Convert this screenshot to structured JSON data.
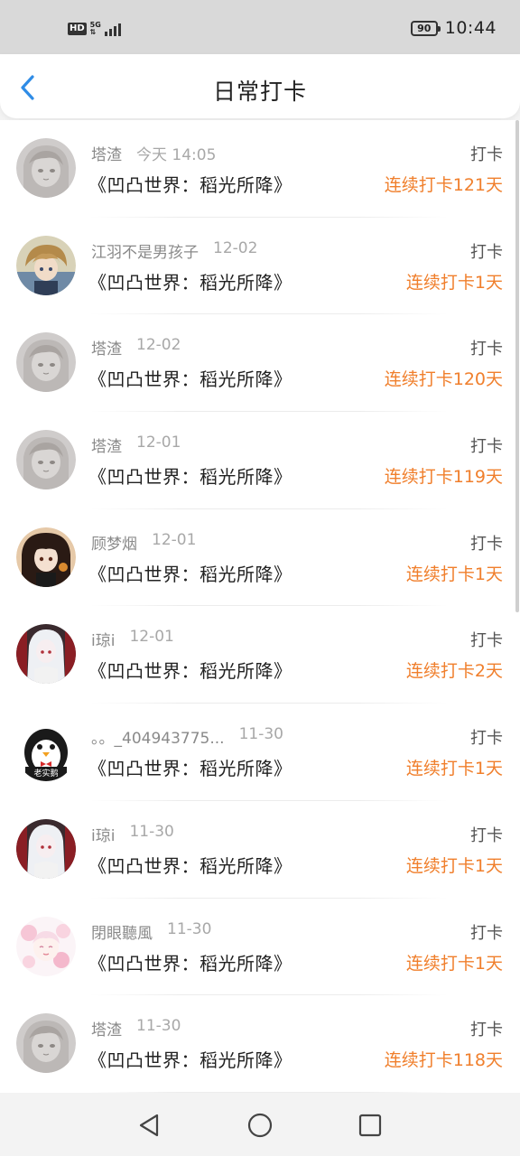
{
  "status_bar": {
    "hd": "HD",
    "network": "5G",
    "battery": "90",
    "time": "10:44",
    "icons": [
      "hd-icon",
      "signal-icon",
      "battery-icon"
    ]
  },
  "header": {
    "title": "日常打卡",
    "back_icon": "chevron-left-icon",
    "accent_color": "#2f8ce6"
  },
  "checkin_label": "打卡",
  "entries": [
    {
      "name": "塔渣",
      "time": "今天 14:05",
      "book": "《凹凸世界：稻光所降》",
      "action": "打卡",
      "streak": "连续打卡121天",
      "avatar": "sketch-girl"
    },
    {
      "name": "江羽不是男孩子",
      "time": "12-02",
      "book": "《凹凸世界：稻光所降》",
      "action": "打卡",
      "streak": "连续打卡1天",
      "avatar": "anime-boy"
    },
    {
      "name": "塔渣",
      "time": "12-02",
      "book": "《凹凸世界：稻光所降》",
      "action": "打卡",
      "streak": "连续打卡120天",
      "avatar": "sketch-girl"
    },
    {
      "name": "塔渣",
      "time": "12-01",
      "book": "《凹凸世界：稻光所降》",
      "action": "打卡",
      "streak": "连续打卡119天",
      "avatar": "sketch-girl"
    },
    {
      "name": "顾梦烟",
      "time": "12-01",
      "book": "《凹凸世界：稻光所降》",
      "action": "打卡",
      "streak": "连续打卡1天",
      "avatar": "dark-hair-girl"
    },
    {
      "name": "i琼i",
      "time": "12-01",
      "book": "《凹凸世界：稻光所降》",
      "action": "打卡",
      "streak": "连续打卡2天",
      "avatar": "white-hair-girl"
    },
    {
      "name": "。。_404943775...",
      "time": "11-30",
      "book": "《凹凸世界：稻光所降》",
      "action": "打卡",
      "streak": "连续打卡1天",
      "avatar": "penguin",
      "avatar_text": "老实鹅"
    },
    {
      "name": "i琼i",
      "time": "11-30",
      "book": "《凹凸世界：稻光所降》",
      "action": "打卡",
      "streak": "连续打卡1天",
      "avatar": "white-hair-girl"
    },
    {
      "name": "閉眼聽風",
      "time": "11-30",
      "book": "《凹凸世界：稻光所降》",
      "action": "打卡",
      "streak": "连续打卡1天",
      "avatar": "pink-flower-girl"
    },
    {
      "name": "塔渣",
      "time": "11-30",
      "book": "《凹凸世界：稻光所降》",
      "action": "打卡",
      "streak": "连续打卡118天",
      "avatar": "sketch-girl"
    }
  ],
  "colors": {
    "streak": "#f07f2c",
    "name": "#8a8a8a",
    "book": "#222222"
  },
  "nav_bar": {
    "icons": [
      "back-triangle-icon",
      "home-circle-icon",
      "recents-square-icon"
    ]
  }
}
